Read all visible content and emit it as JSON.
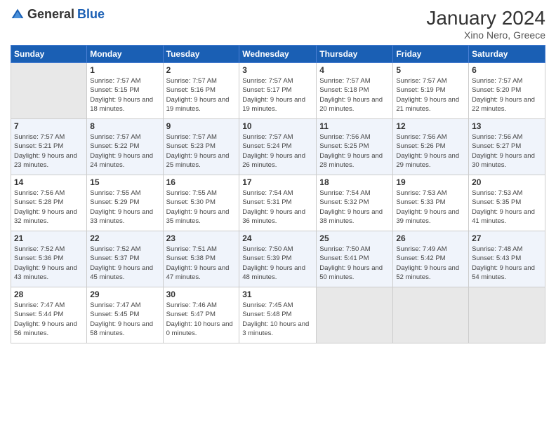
{
  "header": {
    "logo": {
      "text_general": "General",
      "text_blue": "Blue"
    },
    "title": "January 2024",
    "subtitle": "Xino Nero, Greece"
  },
  "weekdays": [
    "Sunday",
    "Monday",
    "Tuesday",
    "Wednesday",
    "Thursday",
    "Friday",
    "Saturday"
  ],
  "weeks": [
    [
      {
        "day": "",
        "empty": true
      },
      {
        "day": "1",
        "sunrise": "7:57 AM",
        "sunset": "5:15 PM",
        "daylight": "9 hours and 18 minutes."
      },
      {
        "day": "2",
        "sunrise": "7:57 AM",
        "sunset": "5:16 PM",
        "daylight": "9 hours and 19 minutes."
      },
      {
        "day": "3",
        "sunrise": "7:57 AM",
        "sunset": "5:17 PM",
        "daylight": "9 hours and 19 minutes."
      },
      {
        "day": "4",
        "sunrise": "7:57 AM",
        "sunset": "5:18 PM",
        "daylight": "9 hours and 20 minutes."
      },
      {
        "day": "5",
        "sunrise": "7:57 AM",
        "sunset": "5:19 PM",
        "daylight": "9 hours and 21 minutes."
      },
      {
        "day": "6",
        "sunrise": "7:57 AM",
        "sunset": "5:20 PM",
        "daylight": "9 hours and 22 minutes."
      }
    ],
    [
      {
        "day": "7",
        "sunrise": "7:57 AM",
        "sunset": "5:21 PM",
        "daylight": "9 hours and 23 minutes."
      },
      {
        "day": "8",
        "sunrise": "7:57 AM",
        "sunset": "5:22 PM",
        "daylight": "9 hours and 24 minutes."
      },
      {
        "day": "9",
        "sunrise": "7:57 AM",
        "sunset": "5:23 PM",
        "daylight": "9 hours and 25 minutes."
      },
      {
        "day": "10",
        "sunrise": "7:57 AM",
        "sunset": "5:24 PM",
        "daylight": "9 hours and 26 minutes."
      },
      {
        "day": "11",
        "sunrise": "7:56 AM",
        "sunset": "5:25 PM",
        "daylight": "9 hours and 28 minutes."
      },
      {
        "day": "12",
        "sunrise": "7:56 AM",
        "sunset": "5:26 PM",
        "daylight": "9 hours and 29 minutes."
      },
      {
        "day": "13",
        "sunrise": "7:56 AM",
        "sunset": "5:27 PM",
        "daylight": "9 hours and 30 minutes."
      }
    ],
    [
      {
        "day": "14",
        "sunrise": "7:56 AM",
        "sunset": "5:28 PM",
        "daylight": "9 hours and 32 minutes."
      },
      {
        "day": "15",
        "sunrise": "7:55 AM",
        "sunset": "5:29 PM",
        "daylight": "9 hours and 33 minutes."
      },
      {
        "day": "16",
        "sunrise": "7:55 AM",
        "sunset": "5:30 PM",
        "daylight": "9 hours and 35 minutes."
      },
      {
        "day": "17",
        "sunrise": "7:54 AM",
        "sunset": "5:31 PM",
        "daylight": "9 hours and 36 minutes."
      },
      {
        "day": "18",
        "sunrise": "7:54 AM",
        "sunset": "5:32 PM",
        "daylight": "9 hours and 38 minutes."
      },
      {
        "day": "19",
        "sunrise": "7:53 AM",
        "sunset": "5:33 PM",
        "daylight": "9 hours and 39 minutes."
      },
      {
        "day": "20",
        "sunrise": "7:53 AM",
        "sunset": "5:35 PM",
        "daylight": "9 hours and 41 minutes."
      }
    ],
    [
      {
        "day": "21",
        "sunrise": "7:52 AM",
        "sunset": "5:36 PM",
        "daylight": "9 hours and 43 minutes."
      },
      {
        "day": "22",
        "sunrise": "7:52 AM",
        "sunset": "5:37 PM",
        "daylight": "9 hours and 45 minutes."
      },
      {
        "day": "23",
        "sunrise": "7:51 AM",
        "sunset": "5:38 PM",
        "daylight": "9 hours and 47 minutes."
      },
      {
        "day": "24",
        "sunrise": "7:50 AM",
        "sunset": "5:39 PM",
        "daylight": "9 hours and 48 minutes."
      },
      {
        "day": "25",
        "sunrise": "7:50 AM",
        "sunset": "5:41 PM",
        "daylight": "9 hours and 50 minutes."
      },
      {
        "day": "26",
        "sunrise": "7:49 AM",
        "sunset": "5:42 PM",
        "daylight": "9 hours and 52 minutes."
      },
      {
        "day": "27",
        "sunrise": "7:48 AM",
        "sunset": "5:43 PM",
        "daylight": "9 hours and 54 minutes."
      }
    ],
    [
      {
        "day": "28",
        "sunrise": "7:47 AM",
        "sunset": "5:44 PM",
        "daylight": "9 hours and 56 minutes."
      },
      {
        "day": "29",
        "sunrise": "7:47 AM",
        "sunset": "5:45 PM",
        "daylight": "9 hours and 58 minutes."
      },
      {
        "day": "30",
        "sunrise": "7:46 AM",
        "sunset": "5:47 PM",
        "daylight": "10 hours and 0 minutes."
      },
      {
        "day": "31",
        "sunrise": "7:45 AM",
        "sunset": "5:48 PM",
        "daylight": "10 hours and 3 minutes."
      },
      {
        "day": "",
        "empty": true
      },
      {
        "day": "",
        "empty": true
      },
      {
        "day": "",
        "empty": true
      }
    ]
  ]
}
